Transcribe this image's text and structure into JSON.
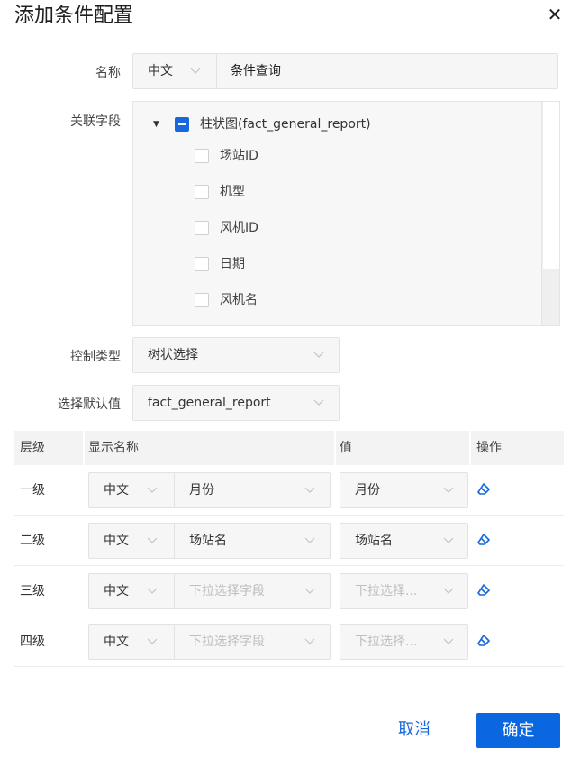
{
  "dialog": {
    "title": "添加条件配置",
    "close_icon": "close-icon"
  },
  "form": {
    "name_label": "名称",
    "name_lang": "中文",
    "name_value": "条件查询",
    "related_label": "关联字段",
    "control_type_label": "控制类型",
    "control_type_value": "树状选择",
    "default_label": "选择默认值",
    "default_value": "fact_general_report"
  },
  "tree": {
    "parent_label": "柱状图(fact_general_report)",
    "parent_checked": "indeterminate",
    "children": [
      {
        "label": "场站ID",
        "checked": false
      },
      {
        "label": "机型",
        "checked": false
      },
      {
        "label": "风机ID",
        "checked": false
      },
      {
        "label": "日期",
        "checked": false
      },
      {
        "label": "风机名",
        "checked": false
      }
    ]
  },
  "table": {
    "headers": {
      "level": "层级",
      "display_name": "显示名称",
      "value": "值",
      "action": "操作"
    },
    "rows": [
      {
        "level": "一级",
        "lang": "中文",
        "field": "月份",
        "field_placeholder": false,
        "value": "月份",
        "value_placeholder": false
      },
      {
        "level": "二级",
        "lang": "中文",
        "field": "场站名",
        "field_placeholder": false,
        "value": "场站名",
        "value_placeholder": false
      },
      {
        "level": "三级",
        "lang": "中文",
        "field": "下拉选择字段",
        "field_placeholder": true,
        "value": "下拉选择...",
        "value_placeholder": true
      },
      {
        "level": "四级",
        "lang": "中文",
        "field": "下拉选择字段",
        "field_placeholder": true,
        "value": "下拉选择...",
        "value_placeholder": true
      }
    ]
  },
  "footer": {
    "cancel_label": "取消",
    "ok_label": "确定"
  },
  "colors": {
    "primary": "#0a67e0",
    "link": "#1668dc",
    "placeholder": "#bfbfbf"
  }
}
